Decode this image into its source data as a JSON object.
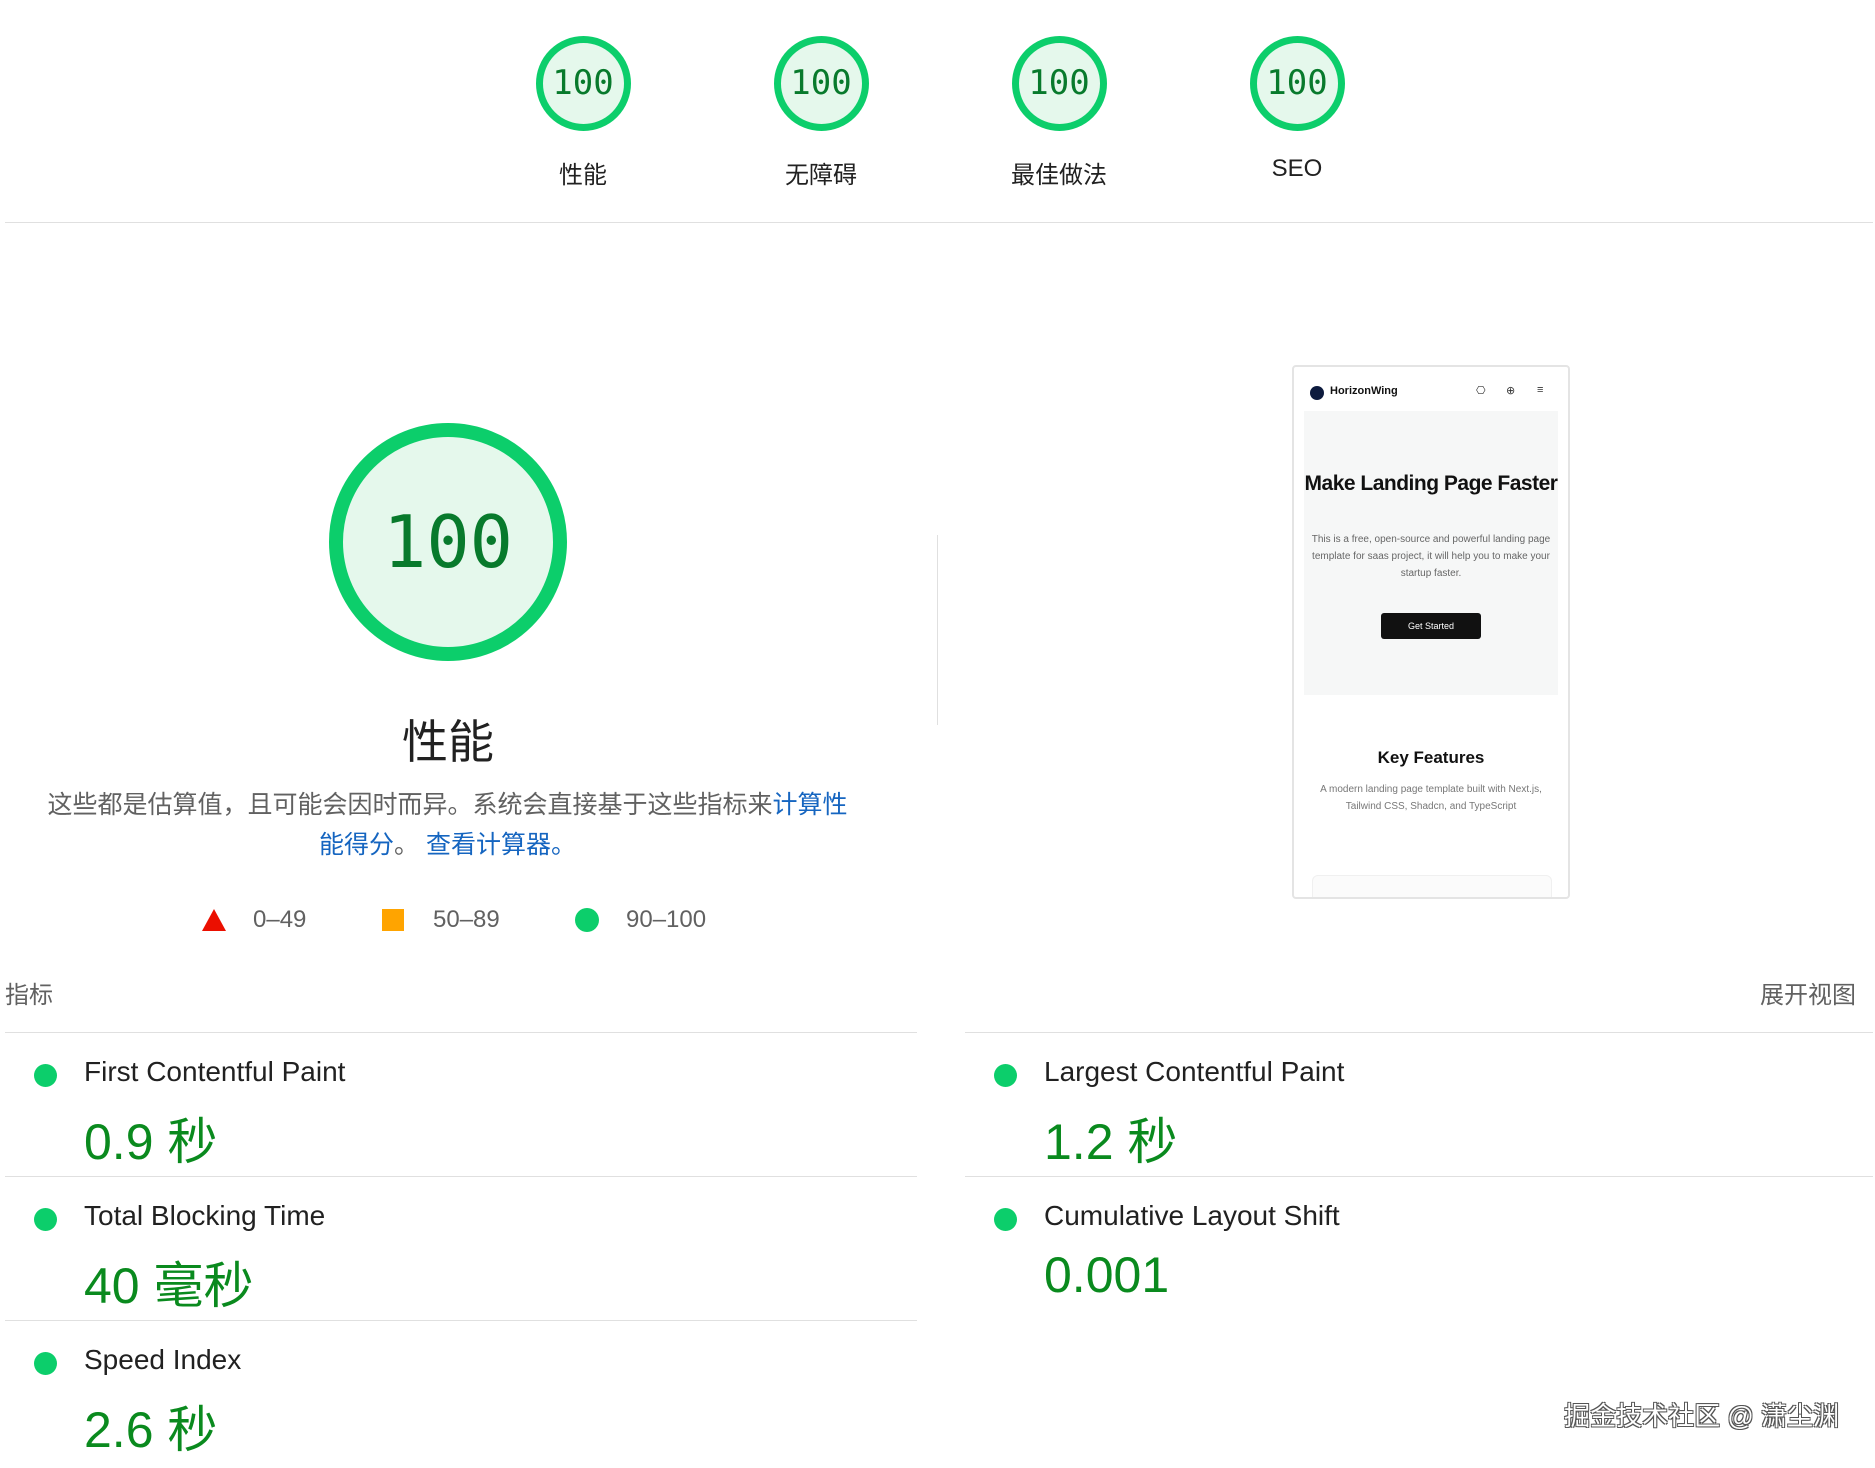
{
  "gauges": [
    {
      "score": "100",
      "label": "性能"
    },
    {
      "score": "100",
      "label": "无障碍"
    },
    {
      "score": "100",
      "label": "最佳做法"
    },
    {
      "score": "100",
      "label": "SEO"
    }
  ],
  "performance": {
    "score": "100",
    "title": "性能",
    "description_text": "这些都是估算值，且可能会因时而异。系统会直接基于这些指标来",
    "calc_link": "计算性能得分",
    "separator": "。",
    "calculator_link": "查看计算器。",
    "colors": {
      "pass": "#0cce6b",
      "pass_text": "#0a8a1e",
      "average": "#ffa400",
      "fail": "#eb0f00"
    }
  },
  "legend": [
    {
      "shape": "triangle",
      "range": "0–49"
    },
    {
      "shape": "square",
      "range": "50–89"
    },
    {
      "shape": "circle",
      "range": "90–100"
    }
  ],
  "preview": {
    "brand": "HorizonWing",
    "nav_icons": [
      "github-icon",
      "globe-icon",
      "menu-icon"
    ],
    "nav_glyphs": [
      "⎔",
      "⊕",
      "≡"
    ],
    "hero_title": "Make Landing Page Faster",
    "hero_text": "This is a free, open-source and powerful landing page template for saas project, it will help you to make your startup faster.",
    "cta": "Get Started",
    "features_title": "Key Features",
    "features_text": "A modern landing page template built with Next.js, Tailwind CSS, Shadcn, and TypeScript"
  },
  "metrics_header": {
    "label": "指标",
    "expand": "展开视图"
  },
  "metrics": [
    {
      "name": "First Contentful Paint",
      "value": "0.9 秒"
    },
    {
      "name": "Largest Contentful Paint",
      "value": "1.2 秒"
    },
    {
      "name": "Total Blocking Time",
      "value": "40 毫秒"
    },
    {
      "name": "Cumulative Layout Shift",
      "value": "0.001"
    },
    {
      "name": "Speed Index",
      "value": "2.6 秒"
    }
  ],
  "watermark": "掘金技术社区 @ 潇尘渊"
}
